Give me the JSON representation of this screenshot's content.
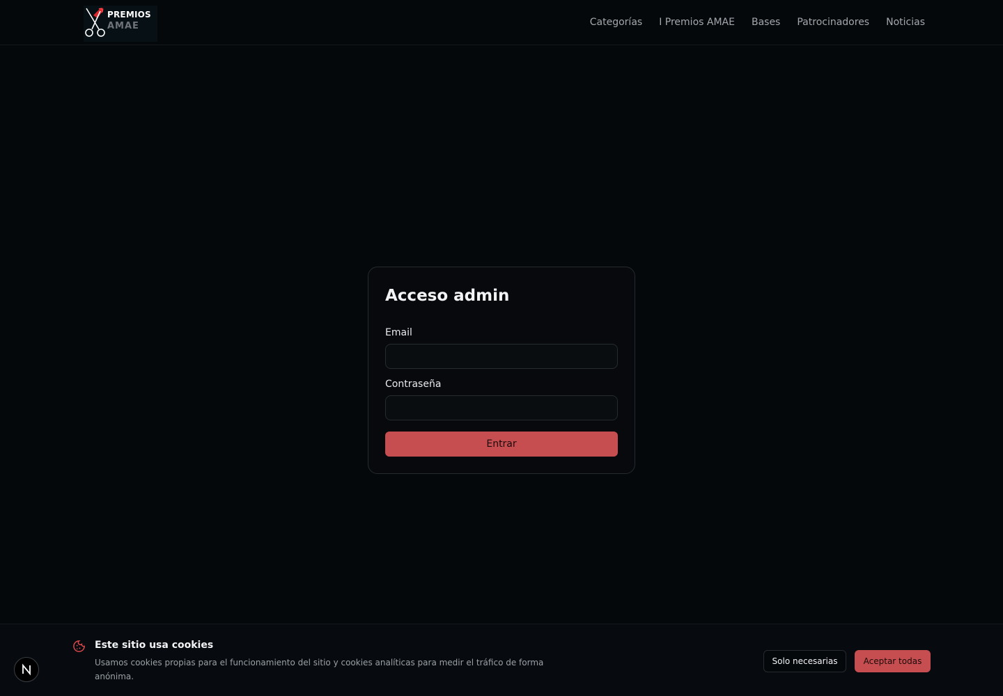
{
  "header": {
    "logo": {
      "top_text": "PREMIOS",
      "bottom_text": "AMAE"
    },
    "nav": [
      {
        "label": "Categorías"
      },
      {
        "label": "I Premios AMAE"
      },
      {
        "label": "Bases"
      },
      {
        "label": "Patrocinadores"
      },
      {
        "label": "Noticias"
      }
    ]
  },
  "login": {
    "title": "Acceso admin",
    "email_label": "Email",
    "email_value": "",
    "password_label": "Contraseña",
    "password_value": "",
    "submit_label": "Entrar"
  },
  "cookies": {
    "title": "Este sitio usa cookies",
    "description": "Usamos cookies propias para el funcionamiento del sitio y cookies analíticas para medir el tráfico de forma anónima.",
    "necessary_label": "Solo necesarias",
    "accept_label": "Aceptar todas"
  },
  "badge": {
    "letter": "N"
  },
  "colors": {
    "background": "#05080b",
    "accent": "#c74e50",
    "nav_text": "#a3a8ad",
    "border": "#262b30"
  },
  "icons": {
    "logo": "scissors-icon",
    "cookie": "cookie-icon",
    "badge": "next-logo-icon"
  }
}
